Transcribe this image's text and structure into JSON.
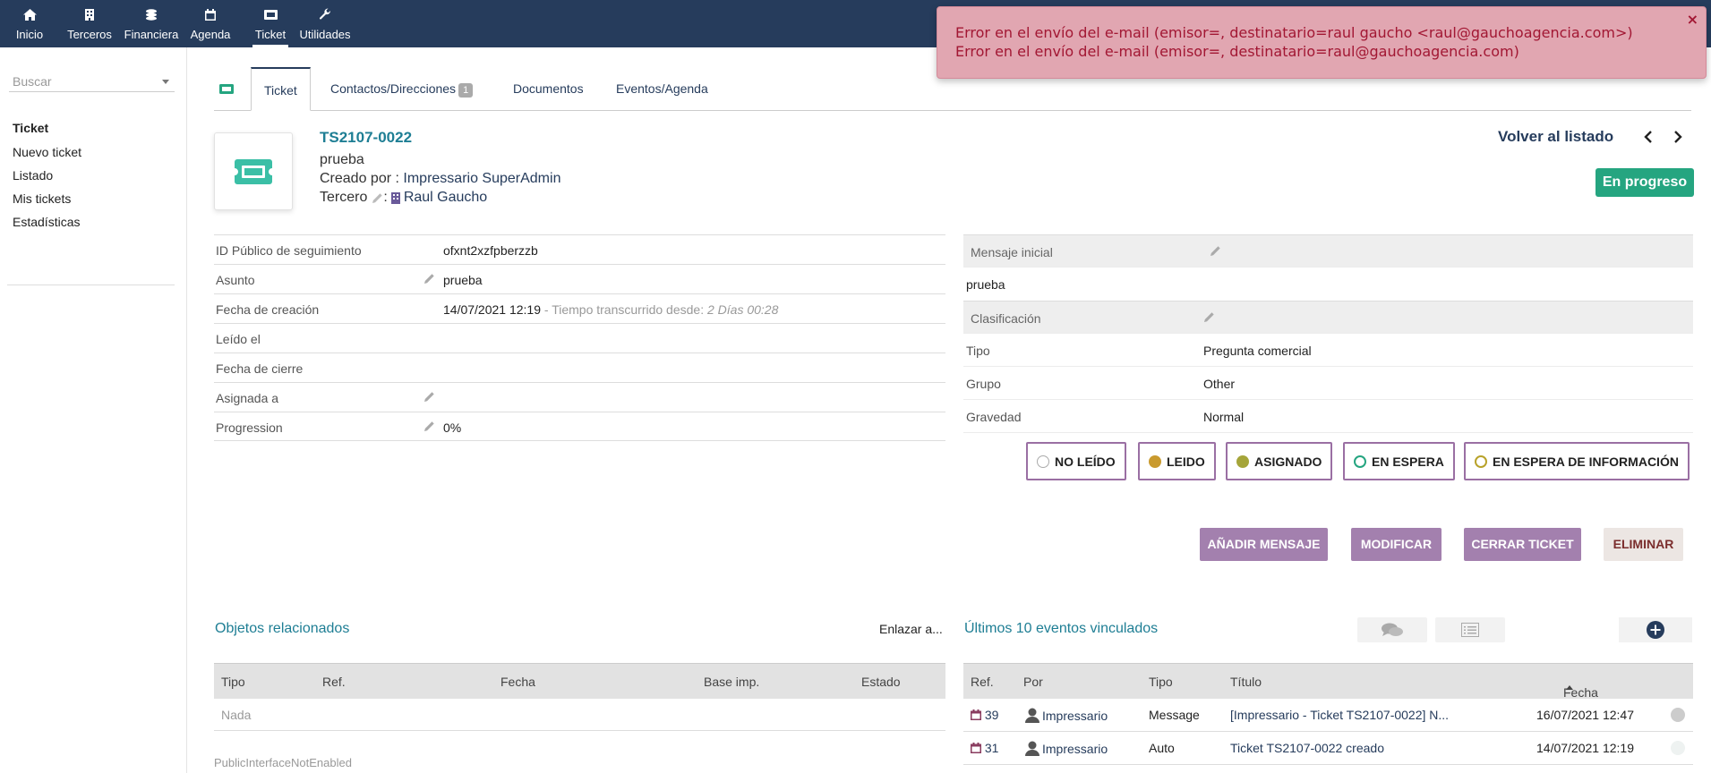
{
  "topmenu": {
    "items": [
      {
        "label": "Inicio",
        "icon": "home-icon"
      },
      {
        "label": "Terceros",
        "icon": "building-icon"
      },
      {
        "label": "Financiera",
        "icon": "coins-icon"
      },
      {
        "label": "Agenda",
        "icon": "calendar-icon"
      },
      {
        "label": "Ticket",
        "icon": "ticket-icon"
      },
      {
        "label": "Utilidades",
        "icon": "wrench-icon"
      }
    ],
    "active": "Ticket"
  },
  "error": {
    "line1": "Error en el envío del e-mail (emisor=, destinatario=raul gaucho <raul@gauchoagencia.com>)",
    "line2": "Error en el envío del e-mail (emisor=, destinatario=raul@gauchoagencia.com)",
    "close": "×"
  },
  "sidebar": {
    "search_placeholder": "Buscar",
    "heading": "Ticket",
    "items": [
      {
        "label": "Nuevo ticket"
      },
      {
        "label": "Listado"
      },
      {
        "label": "Mis tickets"
      },
      {
        "label": "Estadísticas"
      }
    ]
  },
  "tabs": [
    {
      "label": "Ticket"
    },
    {
      "label": "Contactos/Direcciones",
      "badge": "1"
    },
    {
      "label": "Documentos"
    },
    {
      "label": "Eventos/Agenda"
    }
  ],
  "header": {
    "ref": "TS2107-0022",
    "subject": "prueba",
    "created_label": "Creado por : ",
    "created_by": "Impressario SuperAdmin",
    "tercero_label": "Tercero",
    "tercero_sep": " : ",
    "tercero": "Raul Gaucho",
    "back": "Volver al listado",
    "status": "En progreso"
  },
  "fields_left": [
    {
      "label": "ID Público de seguimiento",
      "value": "ofxnt2xzfpberzzb",
      "pencil": false
    },
    {
      "label": "Asunto",
      "value": "prueba",
      "pencil": true
    },
    {
      "label": "Fecha de creación",
      "value": "14/07/2021 12:19",
      "extra": " - Tiempo transcurrido desde: ",
      "extra_italic": "2 Días 00:28",
      "pencil": false
    },
    {
      "label": "Leído el",
      "value": "",
      "pencil": false
    },
    {
      "label": "Fecha de cierre",
      "value": "",
      "pencil": false
    },
    {
      "label": "Asignada a",
      "value": "",
      "pencil": true
    },
    {
      "label": "Progression",
      "value": "0%",
      "pencil": true
    }
  ],
  "fields_right": {
    "initial_message_label": "Mensaje inicial",
    "initial_message": "prueba",
    "classification_label": "Clasificación",
    "rows": [
      {
        "label": "Tipo",
        "value": "Pregunta comercial"
      },
      {
        "label": "Grupo",
        "value": "Other"
      },
      {
        "label": "Gravedad",
        "value": "Normal"
      }
    ]
  },
  "status_buttons": [
    {
      "label": "NO LEÍDO",
      "dot": "#ffffff",
      "ring": "#aaaaaa"
    },
    {
      "label": "LEIDO",
      "dot": "#c99a2e",
      "ring": "#c99a2e"
    },
    {
      "label": "ASIGNADO",
      "dot": "#a5a53a",
      "ring": "#a5a53a"
    },
    {
      "label": "EN ESPERA",
      "dot": "#ffffff",
      "ring": "#25a580"
    },
    {
      "label": "EN ESPERA DE INFORMACIÓN",
      "dot": "#ffffff",
      "ring": "#b8a22a"
    }
  ],
  "actions": {
    "add_message": "AÑADIR MENSAJE",
    "modify": "MODIFICAR",
    "close_ticket": "CERRAR TICKET",
    "delete": "ELIMINAR"
  },
  "related": {
    "title": "Objetos relacionados",
    "link": "Enlazar a...",
    "columns": [
      "Tipo",
      "Ref.",
      "Fecha",
      "Base imp.",
      "Estado"
    ],
    "empty": "Nada",
    "footer": "PublicInterfaceNotEnabled"
  },
  "events": {
    "title": "Últimos 10 eventos vinculados",
    "columns": [
      "Ref.",
      "Por",
      "Tipo",
      "Título",
      "Fecha"
    ],
    "rows": [
      {
        "ref": "39",
        "by": "Impressario",
        "type": "Message",
        "title": "[Impressario - Ticket TS2107-0022] N...",
        "date": "16/07/2021 12:47"
      },
      {
        "ref": "31",
        "by": "Impressario",
        "type": "Auto",
        "title": "Ticket TS2107-0022 creado",
        "date": "14/07/2021 12:19"
      }
    ]
  },
  "colors": {
    "topbar": "#263c5c",
    "accent_teal": "#1e7e94",
    "status_green": "#25a580",
    "button_purple": "#a380ae",
    "error_bg": "#e1a6b1"
  }
}
